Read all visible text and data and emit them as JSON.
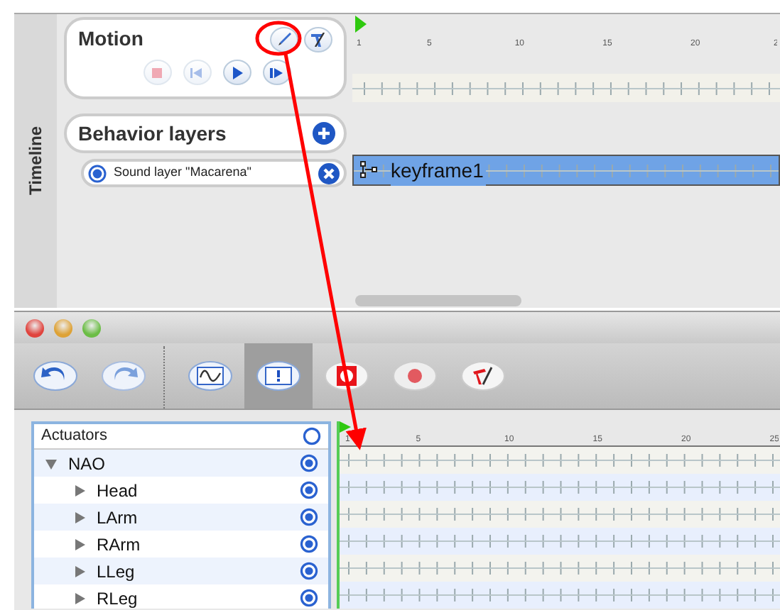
{
  "timeline_panel": {
    "tab_label": "Timeline",
    "motion": {
      "title": "Motion",
      "tools": [
        {
          "kind": "pencil"
        },
        {
          "kind": "tool"
        }
      ],
      "controls": [
        {
          "kind": "stop",
          "disabled": true
        },
        {
          "kind": "back",
          "disabled": true
        },
        {
          "kind": "play",
          "disabled": false
        },
        {
          "kind": "step",
          "disabled": false
        }
      ]
    },
    "behavior_layers": {
      "title": "Behavior layers",
      "layers": [
        {
          "name": "Sound layer \"Macarena\"",
          "selected": true
        }
      ]
    },
    "ruler": [
      "1",
      "5",
      "10",
      "15",
      "20",
      "2"
    ],
    "tracks": [
      {
        "kind": "motion"
      },
      {
        "kind": "keyframe",
        "label": "keyframe1"
      }
    ]
  },
  "editor_window": {
    "toolbar": [
      {
        "kind": "undo",
        "selected": false
      },
      {
        "kind": "redo",
        "selected": false
      },
      {
        "kind": "separator"
      },
      {
        "kind": "curves",
        "selected": false
      },
      {
        "kind": "worksheet",
        "selected": true
      },
      {
        "kind": "record-mode",
        "selected": false
      },
      {
        "kind": "record",
        "selected": false
      },
      {
        "kind": "tools",
        "selected": false
      }
    ],
    "actuators": {
      "header": "Actuators",
      "header_checked": false,
      "tree": [
        {
          "name": "NAO",
          "expanded": true,
          "checked": true,
          "children": [
            {
              "name": "Head",
              "expanded": false,
              "checked": true
            },
            {
              "name": "LArm",
              "expanded": false,
              "checked": true
            },
            {
              "name": "RArm",
              "expanded": false,
              "checked": true
            },
            {
              "name": "LLeg",
              "expanded": false,
              "checked": true
            },
            {
              "name": "RLeg",
              "expanded": false,
              "checked": true
            }
          ]
        }
      ]
    },
    "ruler": [
      "1",
      "5",
      "10",
      "15",
      "20",
      "25"
    ]
  }
}
